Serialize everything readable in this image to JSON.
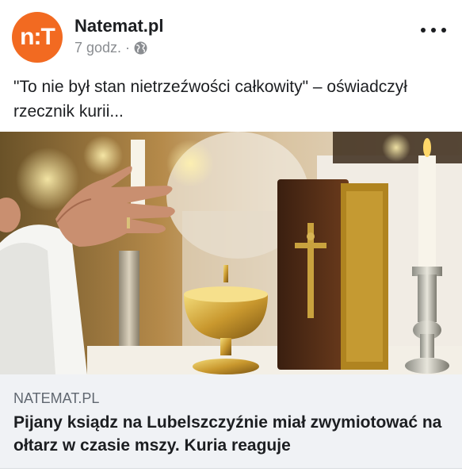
{
  "post": {
    "page_name": "Natemat.pl",
    "avatar_text": "n:T",
    "timestamp": "7 godz.",
    "separator": "·",
    "privacy_icon": "globe-icon",
    "more_icon": "more-dots-icon",
    "text": "\"To nie był stan nietrzeźwości całkowity\" – oświadczył rzecznik kurii...",
    "image_icon": "altar-photo"
  },
  "link_preview": {
    "domain": "NATEMAT.PL",
    "title": "Pijany ksiądz na Lubelszczyźnie miał zwymiotować na ołtarz w czasie mszy. Kuria reaguje"
  },
  "colors": {
    "brand": "#f26a21",
    "text": "#1c1e21",
    "secondary": "#8a8d91",
    "link_bg": "#f0f2f5"
  }
}
